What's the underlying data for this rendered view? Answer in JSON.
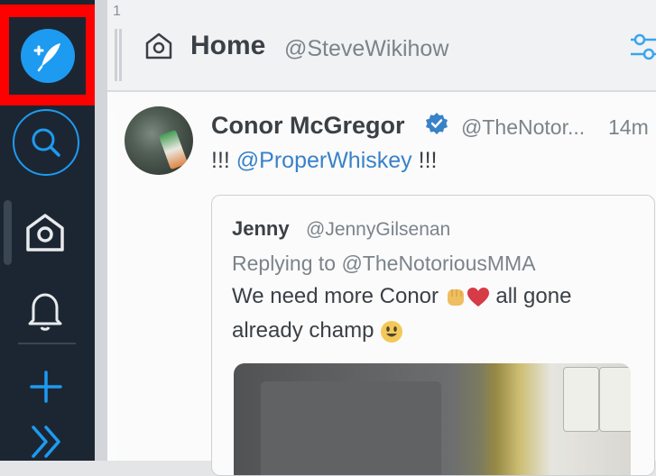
{
  "column": {
    "number": "1",
    "title": "Home",
    "handle": "@SteveWikihow"
  },
  "sidebar": {
    "items": [
      {
        "name": "compose",
        "icon": "compose-feather-icon"
      },
      {
        "name": "search",
        "icon": "search-icon"
      },
      {
        "name": "home",
        "icon": "home-icon"
      },
      {
        "name": "notifications",
        "icon": "bell-icon"
      },
      {
        "name": "add-column",
        "icon": "plus-icon"
      },
      {
        "name": "expand",
        "icon": "chevron-double-right-icon"
      }
    ]
  },
  "tweet": {
    "author_name": "Conor McGregor",
    "author_handle": "@TheNotor...",
    "timestamp": "14m",
    "text_prefix": "!!! ",
    "mention": "@ProperWhiskey",
    "text_suffix": " !!!",
    "quoted": {
      "name": "Jenny",
      "handle": "@JennyGilsenan",
      "replying_to": "Replying to @TheNotoriousMMA",
      "line1_prefix": "We need more Conor ",
      "line1_suffix": " all gone",
      "line2": "already champ "
    }
  },
  "colors": {
    "accent": "#1d9bf0",
    "sidebar_bg": "#1c2633",
    "highlight": "#ff0000",
    "mention": "#1d72c4"
  }
}
